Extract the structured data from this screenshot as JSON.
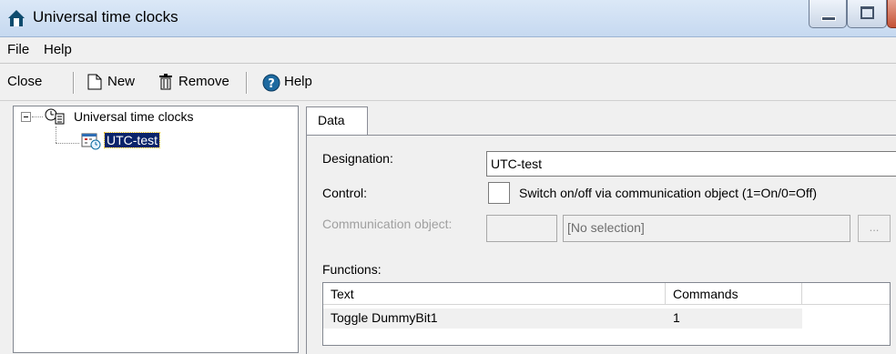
{
  "window": {
    "title": "Universal time clocks"
  },
  "menu": [
    "File",
    "Help"
  ],
  "toolbar": {
    "close": "Close",
    "new": "New",
    "remove": "Remove",
    "help": "Help"
  },
  "tree": {
    "root": "Universal time clocks",
    "children": [
      "UTC-test"
    ]
  },
  "tab": {
    "label": "Data"
  },
  "form": {
    "designation_label": "Designation:",
    "designation_value": "UTC-test",
    "control_label": "Control:",
    "control_checkbox_label": "Switch on/off via communication object (1=On/0=Off)",
    "control_checked": false,
    "comm_object_label": "Communication object:",
    "comm_object_selection": "[No selection]",
    "browse_label": "...",
    "functions_label": "Functions:"
  },
  "functions_table": {
    "columns": [
      "Text",
      "Commands"
    ],
    "rows": [
      {
        "text": "Toggle DummyBit1",
        "commands": "1"
      }
    ]
  },
  "colors": {
    "titlebar": "#c6d9f0",
    "selection": "#0a246a"
  }
}
